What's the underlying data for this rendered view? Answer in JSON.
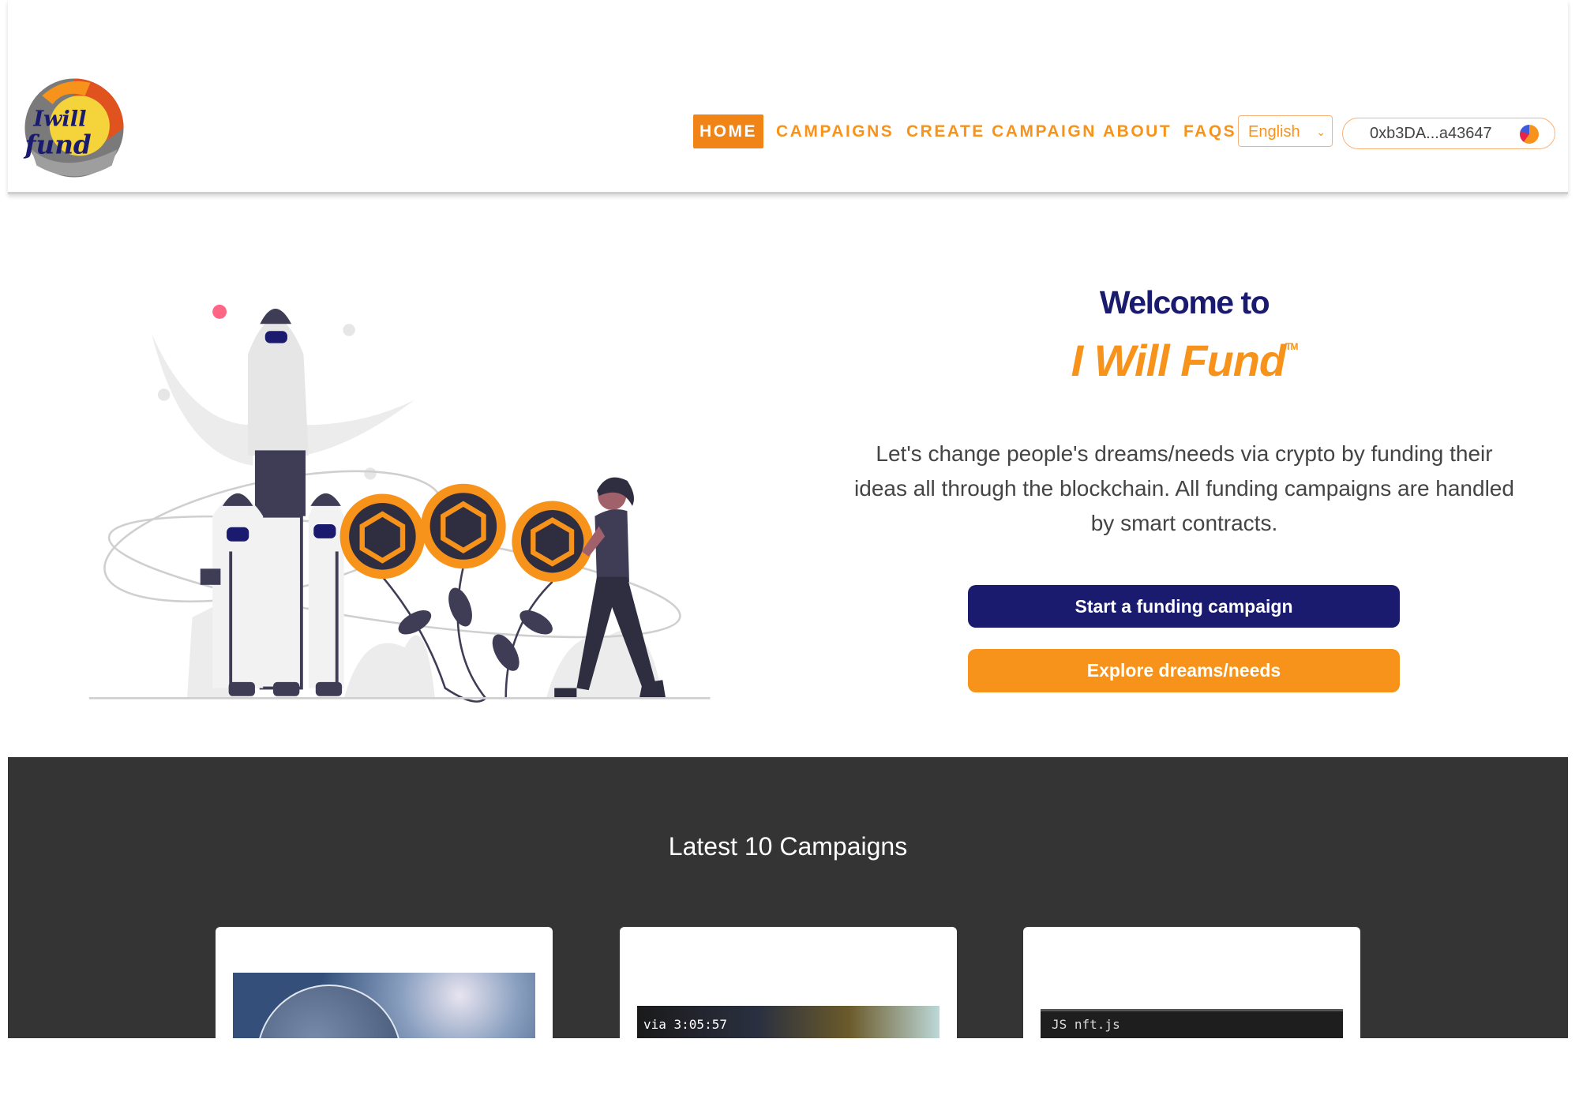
{
  "header": {
    "logo_text": "I will fund",
    "nav": [
      {
        "label": "HOME",
        "active": true
      },
      {
        "label": "CAMPAIGNS",
        "active": false
      },
      {
        "label": "CREATE CAMPAIGN",
        "active": false
      },
      {
        "label": "ABOUT",
        "active": false
      },
      {
        "label": "FAQS",
        "active": false
      }
    ],
    "language": {
      "selected": "English"
    },
    "wallet": {
      "address": "0xb3DA...a43647",
      "icon": "wallet-avatar-icon"
    }
  },
  "hero": {
    "welcome": "Welcome to",
    "brand": "I Will Fund",
    "trademark": "TM",
    "description": "Let's change people's dreams/needs via crypto by funding their ideas all through the blockchain. All funding campaigns are handled by smart contracts.",
    "primary_button": "Start a funding campaign",
    "secondary_button": "Explore dreams/needs"
  },
  "campaigns": {
    "title": "Latest 10 Campaigns",
    "cards": [
      {
        "image": "earth-space-image"
      },
      {
        "image": "video-screenshot-image",
        "overlay_text": "via 3:05:57"
      },
      {
        "image": "code-editor-image",
        "overlay_text": "JS nft.js"
      }
    ]
  },
  "colors": {
    "orange": "#f7931a",
    "navy": "#1a1a6e",
    "dark_section": "#343434"
  }
}
